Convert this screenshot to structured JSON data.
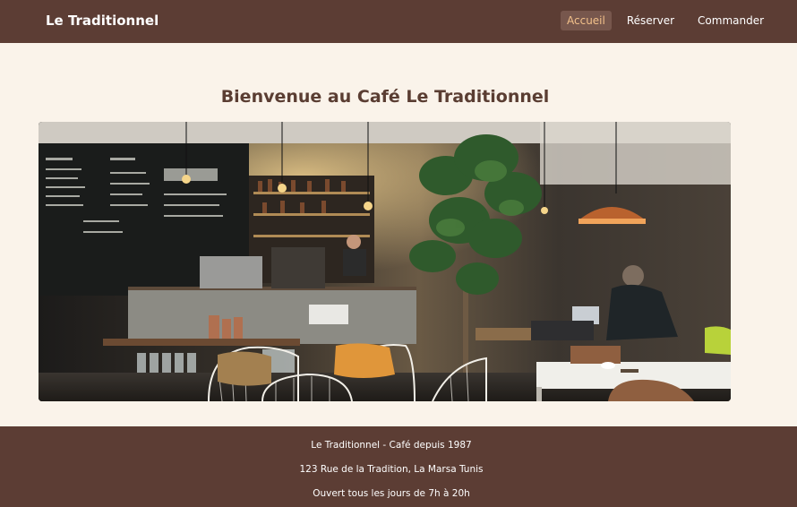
{
  "header": {
    "brand": "Le Traditionnel",
    "nav": [
      {
        "label": "Accueil",
        "active": true
      },
      {
        "label": "Réserver",
        "active": false
      },
      {
        "label": "Commander",
        "active": false
      }
    ]
  },
  "main": {
    "title": "Bienvenue au Café Le Traditionnel",
    "hero_image": {
      "alt": "cafe-interior-photo"
    }
  },
  "footer": {
    "line1": "Le Traditionnel - Café depuis 1987",
    "line2": "123 Rue de la Tradition, La Marsa Tunis",
    "line3": "Ouvert tous les jours de 7h à 20h"
  },
  "colors": {
    "header_bg": "#5c3d34",
    "page_bg": "#faf3ea",
    "title": "#5a3d32",
    "active_nav_text": "#f2c08a"
  }
}
